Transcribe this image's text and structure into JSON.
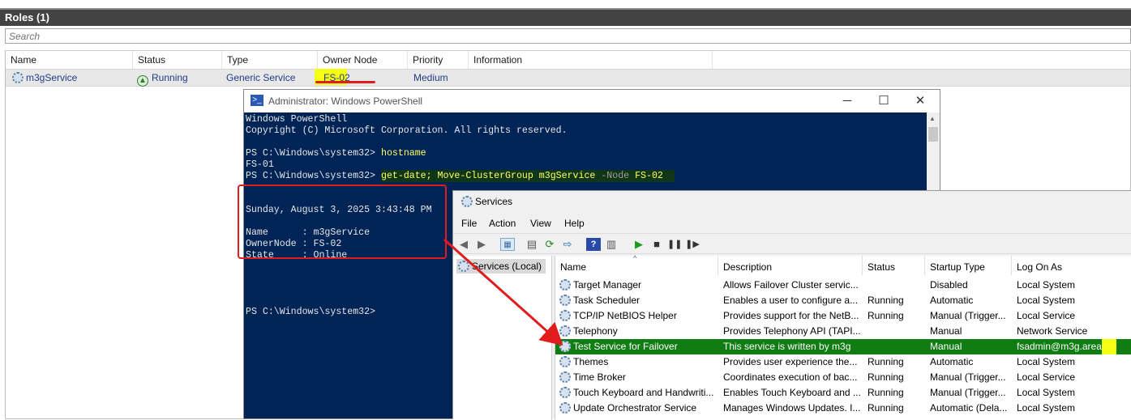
{
  "roles": {
    "title": "Roles (1)",
    "search_placeholder": "Search",
    "columns": [
      "Name",
      "Status",
      "Type",
      "Owner Node",
      "Priority",
      "Information"
    ],
    "row": {
      "name": "m3gService",
      "status": "Running",
      "type": "Generic Service",
      "owner_node": "FS-02",
      "priority": "Medium",
      "information": ""
    }
  },
  "powershell": {
    "title": "Administrator: Windows PowerShell",
    "lines": {
      "l1": "Windows PowerShell",
      "l2": "Copyright (C) Microsoft Corporation. All rights reserved.",
      "prompt1": "PS C:\\Windows\\system32> ",
      "cmd1": "hostname",
      "out1": "FS-01",
      "prompt2": "PS C:\\Windows\\system32> ",
      "cmd2a": "get-date; Move-ClusterGroup m3gService ",
      "cmd2b": "-Node",
      "cmd2c": " FS-02",
      "date": "Sunday, August 3, 2025 3:43:48 PM",
      "name_line": "Name      : m3gService",
      "owner_line": "OwnerNode : FS-02",
      "state_line": "State     : Online",
      "prompt3": "PS C:\\Windows\\system32>"
    }
  },
  "services": {
    "title": "Services",
    "menu": [
      "File",
      "Action",
      "View",
      "Help"
    ],
    "tree_item": "Services (Local)",
    "columns": [
      "Name",
      "Description",
      "Status",
      "Startup Type",
      "Log On As"
    ],
    "rows": [
      {
        "name": "Target Manager",
        "description": "Allows Failover Cluster servic...",
        "status": "",
        "startup": "Disabled",
        "logon": "Local System"
      },
      {
        "name": "Task Scheduler",
        "description": "Enables a user to configure a...",
        "status": "Running",
        "startup": "Automatic",
        "logon": "Local System"
      },
      {
        "name": "TCP/IP NetBIOS Helper",
        "description": "Provides support for the NetB...",
        "status": "Running",
        "startup": "Manual (Trigger...",
        "logon": "Local Service"
      },
      {
        "name": "Telephony",
        "description": "Provides Telephony API (TAPI...",
        "status": "",
        "startup": "Manual",
        "logon": "Network Service"
      },
      {
        "name": "Test Service for Failover",
        "description": "This service is written by m3g",
        "status": "",
        "startup": "Manual",
        "logon": "fsadmin@m3g.area"
      },
      {
        "name": "Themes",
        "description": "Provides user experience the...",
        "status": "Running",
        "startup": "Automatic",
        "logon": "Local System"
      },
      {
        "name": "Time Broker",
        "description": "Coordinates execution of bac...",
        "status": "Running",
        "startup": "Manual (Trigger...",
        "logon": "Local Service"
      },
      {
        "name": "Touch Keyboard and Handwriti...",
        "description": "Enables Touch Keyboard and ...",
        "status": "Running",
        "startup": "Manual (Trigger...",
        "logon": "Local System"
      },
      {
        "name": "Update Orchestrator Service",
        "description": "Manages Windows Updates. I...",
        "status": "Running",
        "startup": "Automatic (Dela...",
        "logon": "Local System"
      }
    ]
  },
  "colors": {
    "powershell_bg": "#012456",
    "highlight_green": "#0f7d12",
    "annotation_red": "#e01c1c",
    "annotation_yellow": "#f5ff14"
  }
}
